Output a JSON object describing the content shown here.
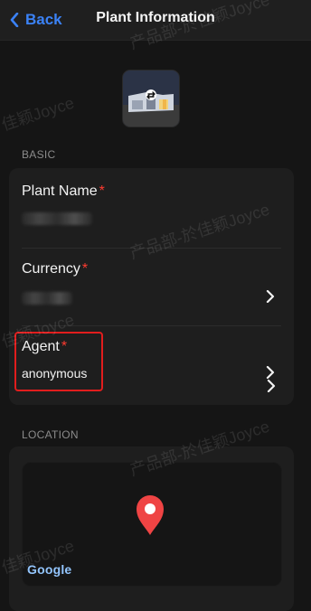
{
  "nav": {
    "back_label": "Back",
    "title": "Plant Information"
  },
  "sections": {
    "basic": "BASIC",
    "location": "LOCATION"
  },
  "fields": {
    "plant_name": {
      "label": "Plant Name",
      "required_mark": "*"
    },
    "currency": {
      "label": "Currency",
      "required_mark": "*"
    },
    "agent": {
      "label": "Agent",
      "required_mark": "*",
      "value": "anonymous"
    }
  },
  "map": {
    "provider": "Google"
  },
  "watermark": {
    "text_1": "佳颖Joyce",
    "text_2": "产品部-於佳颖Joyce",
    "text_3": "产品部-於佳颖Joyce",
    "text_4": "佳颖Joyce",
    "text_5": "产品部-於佳颖Joyce",
    "text_6": "佳颖Joyce"
  },
  "colors": {
    "accent": "#3b82f6",
    "required": "#ff3b30",
    "highlight": "#e11d1d",
    "pin": "#ef4444"
  },
  "icons": {
    "back": "chevron-left-icon",
    "chevron": "chevron-right-icon",
    "pin": "map-pin-icon",
    "hero": "plant-thumbnail-icon"
  }
}
